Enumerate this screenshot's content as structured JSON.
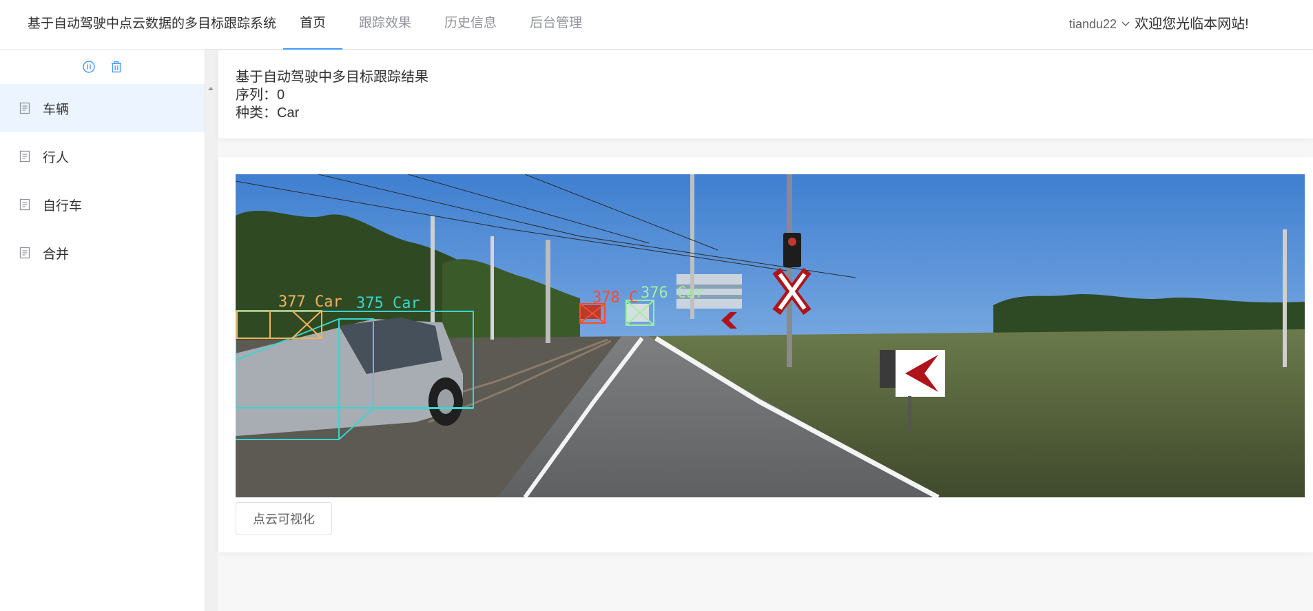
{
  "header": {
    "title": "基于自动驾驶中点云数据的多目标跟踪系统",
    "nav": [
      {
        "label": "首页",
        "active": true
      },
      {
        "label": "跟踪效果",
        "active": false
      },
      {
        "label": "历史信息",
        "active": false
      },
      {
        "label": "后台管理",
        "active": false
      }
    ],
    "user": "tiandu22",
    "welcome": "欢迎您光临本网站!"
  },
  "sidebar": {
    "tools": [
      "pause-icon",
      "trash-icon"
    ],
    "items": [
      {
        "label": "车辆",
        "active": true
      },
      {
        "label": "行人",
        "active": false
      },
      {
        "label": "自行车",
        "active": false
      },
      {
        "label": "合并",
        "active": false
      }
    ]
  },
  "info": {
    "title": "基于自动驾驶中多目标跟踪结果",
    "sequence": "序列：0",
    "category": "种类：Car"
  },
  "scene": {
    "labels": [
      "377 Car",
      "375 Car",
      "378 C",
      "376 Car"
    ],
    "colors": {
      "box_377": "#f2b45e",
      "box_375": "#39d6d0",
      "box_378": "#ff4a2a",
      "box_376": "#9ff0a0"
    }
  },
  "button": {
    "pointcloud": "点云可视化"
  },
  "theme": {
    "accent": "#409eff",
    "active_bg": "#ecf5ff"
  }
}
